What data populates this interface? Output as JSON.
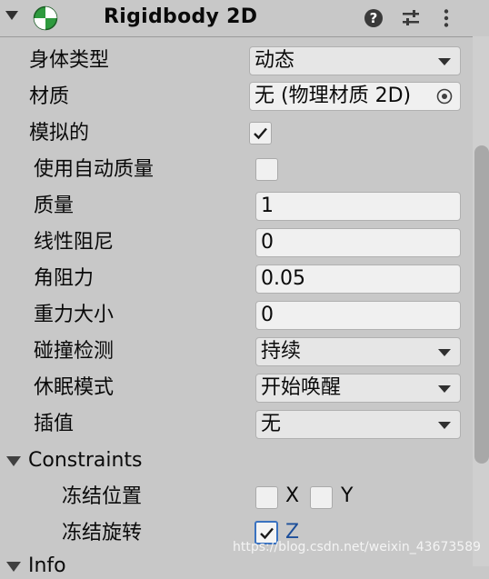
{
  "header": {
    "title": "Rigidbody 2D",
    "icons": [
      "rigidbody-component-icon",
      "help-icon",
      "preset-icon",
      "more-options-icon"
    ]
  },
  "props": {
    "body_type": {
      "label": "身体类型",
      "value": "动态"
    },
    "material": {
      "label": "材质",
      "value": "无 (物理材质 2D)"
    },
    "simulated": {
      "label": "模拟的",
      "checked": true
    },
    "use_auto_mass": {
      "label": "使用自动质量",
      "checked": false
    },
    "mass": {
      "label": "质量",
      "value": "1"
    },
    "linear_drag": {
      "label": "线性阻尼",
      "value": "0"
    },
    "angular_drag": {
      "label": "角阻力",
      "value": "0.05"
    },
    "gravity_scale": {
      "label": "重力大小",
      "value": "0"
    },
    "collision_detection": {
      "label": "碰撞检测",
      "value": "持续"
    },
    "sleeping_mode": {
      "label": "休眠模式",
      "value": "开始唤醒"
    },
    "interpolate": {
      "label": "插值",
      "value": "无"
    }
  },
  "constraints": {
    "label": "Constraints",
    "freeze_position": {
      "label": "冻结位置",
      "x_label": "X",
      "y_label": "Y",
      "x": false,
      "y": false
    },
    "freeze_rotation": {
      "label": "冻结旋转",
      "z_label": "Z",
      "z": true
    }
  },
  "info": {
    "label": "Info"
  },
  "watermark": "https://blog.csdn.net/weixin_43673589",
  "colors": {
    "panel_bg": "#c8c8c8",
    "field_bg": "#f0f0f0",
    "focus_blue": "#3a72c0",
    "component_icon_green": "#2e9a3e"
  }
}
